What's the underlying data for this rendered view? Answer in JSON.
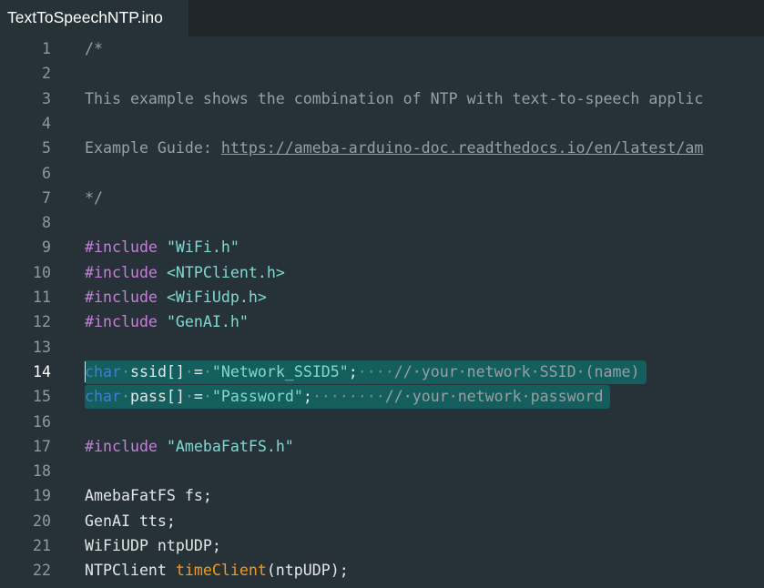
{
  "tab": {
    "filename": "TextToSpeechNTP.ino"
  },
  "colors": {
    "background": "#263238",
    "selection": "#155e5e",
    "comment": "#93a0a5",
    "directive": "#c67fd8",
    "string": "#7fd9d0",
    "type": "#3e7fd0",
    "function": "#f39a1b"
  },
  "editor": {
    "active_line": 14,
    "lines": [
      {
        "n": "1",
        "tokens": [
          {
            "k": "comment",
            "t": "/*"
          }
        ]
      },
      {
        "n": "2",
        "tokens": []
      },
      {
        "n": "3",
        "tokens": [
          {
            "k": "comment",
            "t": "This example shows the combination of NTP with text-to-speech applic"
          }
        ]
      },
      {
        "n": "4",
        "tokens": []
      },
      {
        "n": "5",
        "tokens": [
          {
            "k": "comment",
            "t": "Example Guide: "
          },
          {
            "k": "link",
            "t": "https://ameba-arduino-doc.readthedocs.io/en/latest/am"
          }
        ]
      },
      {
        "n": "6",
        "tokens": []
      },
      {
        "n": "7",
        "tokens": [
          {
            "k": "comment",
            "t": "*/"
          }
        ]
      },
      {
        "n": "8",
        "tokens": []
      },
      {
        "n": "9",
        "tokens": [
          {
            "k": "directive",
            "t": "#include"
          },
          {
            "k": "plain",
            "t": " "
          },
          {
            "k": "string",
            "t": "\"WiFi.h\""
          }
        ]
      },
      {
        "n": "10",
        "tokens": [
          {
            "k": "directive",
            "t": "#include"
          },
          {
            "k": "plain",
            "t": " "
          },
          {
            "k": "string",
            "t": "<NTPClient.h>"
          }
        ]
      },
      {
        "n": "11",
        "tokens": [
          {
            "k": "directive",
            "t": "#include"
          },
          {
            "k": "plain",
            "t": " "
          },
          {
            "k": "string",
            "t": "<WiFiUdp.h>"
          }
        ]
      },
      {
        "n": "12",
        "tokens": [
          {
            "k": "directive",
            "t": "#include"
          },
          {
            "k": "plain",
            "t": " "
          },
          {
            "k": "string",
            "t": "\"GenAI.h\""
          }
        ]
      },
      {
        "n": "13",
        "tokens": []
      },
      {
        "n": "14",
        "selected": true,
        "tokens": [
          {
            "k": "type",
            "t": "char"
          },
          {
            "k": "ws",
            "t": "·"
          },
          {
            "k": "plain",
            "t": "ssid[]"
          },
          {
            "k": "ws",
            "t": "·"
          },
          {
            "k": "op",
            "t": "="
          },
          {
            "k": "ws",
            "t": "·"
          },
          {
            "k": "string",
            "t": "\"Network_SSID5\""
          },
          {
            "k": "plain",
            "t": ";"
          },
          {
            "k": "ws",
            "t": "····"
          },
          {
            "k": "comment",
            "t": "//·your·network·SSID·(name)"
          }
        ]
      },
      {
        "n": "15",
        "selected": true,
        "tokens": [
          {
            "k": "type",
            "t": "char"
          },
          {
            "k": "ws",
            "t": "·"
          },
          {
            "k": "plain",
            "t": "pass[]"
          },
          {
            "k": "ws",
            "t": "·"
          },
          {
            "k": "op",
            "t": "="
          },
          {
            "k": "ws",
            "t": "·"
          },
          {
            "k": "string",
            "t": "\"Password\""
          },
          {
            "k": "plain",
            "t": ";"
          },
          {
            "k": "ws",
            "t": "········"
          },
          {
            "k": "comment",
            "t": "//·your·network·password"
          }
        ]
      },
      {
        "n": "16",
        "tokens": []
      },
      {
        "n": "17",
        "tokens": [
          {
            "k": "directive",
            "t": "#include"
          },
          {
            "k": "plain",
            "t": " "
          },
          {
            "k": "string",
            "t": "\"AmebaFatFS.h\""
          }
        ]
      },
      {
        "n": "18",
        "tokens": []
      },
      {
        "n": "19",
        "tokens": [
          {
            "k": "plain",
            "t": "AmebaFatFS fs;"
          }
        ]
      },
      {
        "n": "20",
        "tokens": [
          {
            "k": "plain",
            "t": "GenAI tts;"
          }
        ]
      },
      {
        "n": "21",
        "tokens": [
          {
            "k": "plain",
            "t": "WiFiUDP ntpUDP;"
          }
        ]
      },
      {
        "n": "22",
        "tokens": [
          {
            "k": "plain",
            "t": "NTPClient "
          },
          {
            "k": "func",
            "t": "timeClient"
          },
          {
            "k": "plain",
            "t": "(ntpUDP);"
          }
        ]
      }
    ]
  }
}
